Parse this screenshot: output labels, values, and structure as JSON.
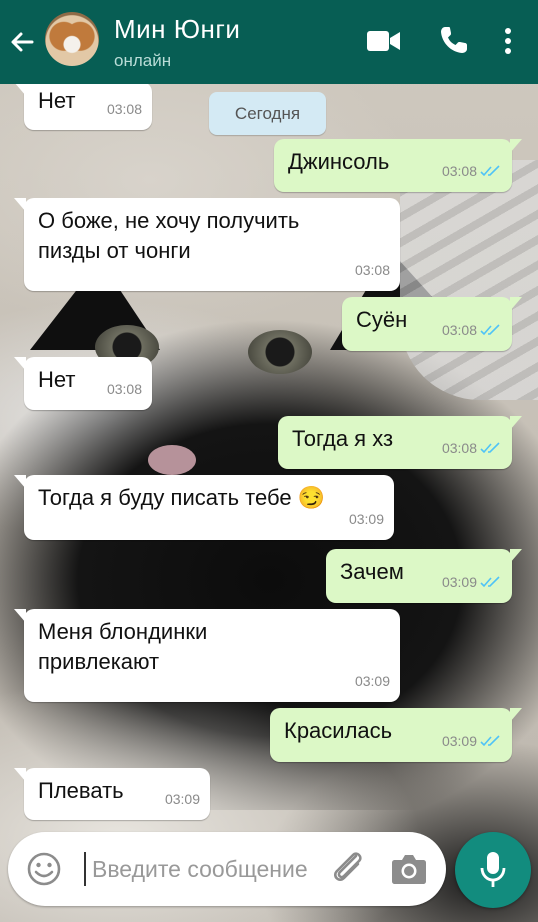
{
  "header": {
    "contact_name": "Мин Юнги",
    "status": "онлайн"
  },
  "date_chip": "Сегодня",
  "messages": [
    {
      "direction": "in",
      "text": "Нет",
      "time": "03:08"
    },
    {
      "direction": "out",
      "text": "Джинсоль",
      "time": "03:08",
      "read": true
    },
    {
      "direction": "in",
      "text": "О боже, не хочу получить\nпизды от чонги",
      "time": "03:08"
    },
    {
      "direction": "out",
      "text": "Суён",
      "time": "03:08",
      "read": true
    },
    {
      "direction": "in",
      "text": "Нет",
      "time": "03:08"
    },
    {
      "direction": "out",
      "text": "Тогда я хз",
      "time": "03:08",
      "read": true
    },
    {
      "direction": "in",
      "text": "Тогда я буду писать тебе 😏",
      "time": "03:09"
    },
    {
      "direction": "out",
      "text": "Зачем",
      "time": "03:09",
      "read": true
    },
    {
      "direction": "in",
      "text": "Меня блондинки\nпривлекают",
      "time": "03:09"
    },
    {
      "direction": "out",
      "text": "Красилась",
      "time": "03:09",
      "read": true
    },
    {
      "direction": "in",
      "text": "Плевать",
      "time": "03:09"
    }
  ],
  "composer": {
    "placeholder": "Введите сообщение"
  },
  "colors": {
    "app_bar": "#075e54",
    "outgoing_bubble": "#dcf8c6",
    "incoming_bubble": "#ffffff",
    "read_ticks": "#4fc3f7",
    "mic_button": "#128c7e"
  },
  "icons": [
    "back-arrow-icon",
    "video-call-icon",
    "phone-icon",
    "menu-dots-icon",
    "emoji-icon",
    "attach-icon",
    "camera-icon",
    "mic-icon"
  ]
}
